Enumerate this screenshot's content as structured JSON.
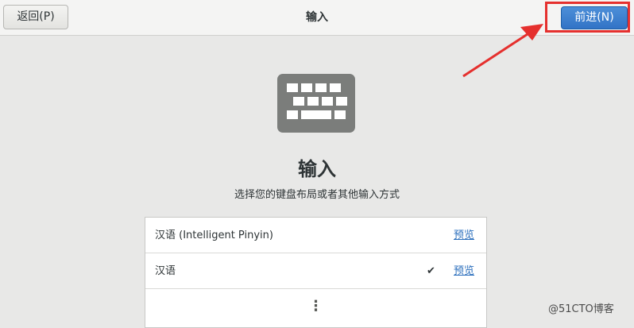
{
  "header": {
    "back_label": "返回(P)",
    "title": "输入",
    "next_label": "前进(N)"
  },
  "main": {
    "icon": "keyboard-icon",
    "title": "输入",
    "subtitle": "选择您的键盘布局或者其他输入方式"
  },
  "inputs": [
    {
      "name": "汉语 (Intelligent Pinyin)",
      "preview": "预览",
      "selected": false
    },
    {
      "name": "汉语",
      "preview": "预览",
      "selected": true,
      "check": "✔"
    }
  ],
  "more_icon": "vertical-ellipsis-icon",
  "more_text": "⋮",
  "annotation": {
    "box_color": "#e5302e",
    "arrow_color": "#e5302e"
  },
  "watermark": "@51CTO博客"
}
